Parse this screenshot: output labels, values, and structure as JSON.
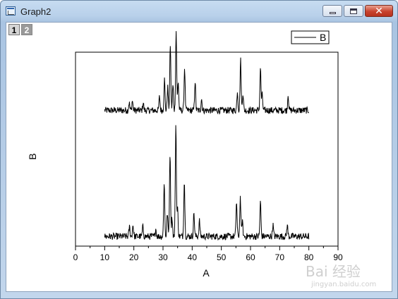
{
  "window": {
    "title": "Graph2",
    "icon": "graph-window-icon",
    "buttons": [
      "minimize",
      "maximize",
      "close"
    ]
  },
  "layers": [
    {
      "label": "1",
      "active": true
    },
    {
      "label": "2",
      "active": false
    }
  ],
  "watermark": {
    "text": "Bai 经验",
    "url": "jingyan.baidu.com"
  },
  "chart_data": {
    "type": "line",
    "xlabel": "A",
    "ylabel": "B",
    "xlim": [
      0,
      90
    ],
    "xticks": [
      0,
      10,
      20,
      30,
      40,
      50,
      60,
      70,
      80,
      90
    ],
    "y_ticks_shown": false,
    "legend": {
      "position": "top-right",
      "entries": [
        "B"
      ]
    },
    "grid": false,
    "series": [
      {
        "name": "B",
        "x_range": [
          10,
          80
        ],
        "baseline": 0.7,
        "peaks": [
          [
            18.4,
            0.04
          ],
          [
            19.5,
            0.05
          ],
          [
            23.2,
            0.04
          ],
          [
            28.8,
            0.07
          ],
          [
            30.5,
            0.16
          ],
          [
            31.6,
            0.12
          ],
          [
            32.5,
            0.34
          ],
          [
            33.4,
            0.13
          ],
          [
            34.5,
            0.41
          ],
          [
            35.2,
            0.15
          ],
          [
            37.4,
            0.22
          ],
          [
            41.0,
            0.15
          ],
          [
            43.2,
            0.06
          ],
          [
            55.5,
            0.1
          ],
          [
            56.6,
            0.26
          ],
          [
            57.4,
            0.09
          ],
          [
            63.4,
            0.22
          ],
          [
            64.0,
            0.08
          ],
          [
            72.9,
            0.08
          ]
        ]
      },
      {
        "name": "B",
        "x_range": [
          10,
          80
        ],
        "baseline": 0.05,
        "peaks": [
          [
            18.5,
            0.05
          ],
          [
            19.7,
            0.06
          ],
          [
            23.1,
            0.05
          ],
          [
            27.5,
            0.04
          ],
          [
            30.4,
            0.28
          ],
          [
            31.5,
            0.12
          ],
          [
            32.4,
            0.43
          ],
          [
            33.1,
            0.1
          ],
          [
            34.4,
            0.58
          ],
          [
            35.0,
            0.14
          ],
          [
            37.3,
            0.29
          ],
          [
            40.6,
            0.12
          ],
          [
            42.5,
            0.08
          ],
          [
            55.2,
            0.18
          ],
          [
            56.5,
            0.2
          ],
          [
            57.2,
            0.08
          ],
          [
            63.4,
            0.18
          ],
          [
            67.7,
            0.06
          ],
          [
            72.6,
            0.06
          ]
        ]
      }
    ]
  }
}
